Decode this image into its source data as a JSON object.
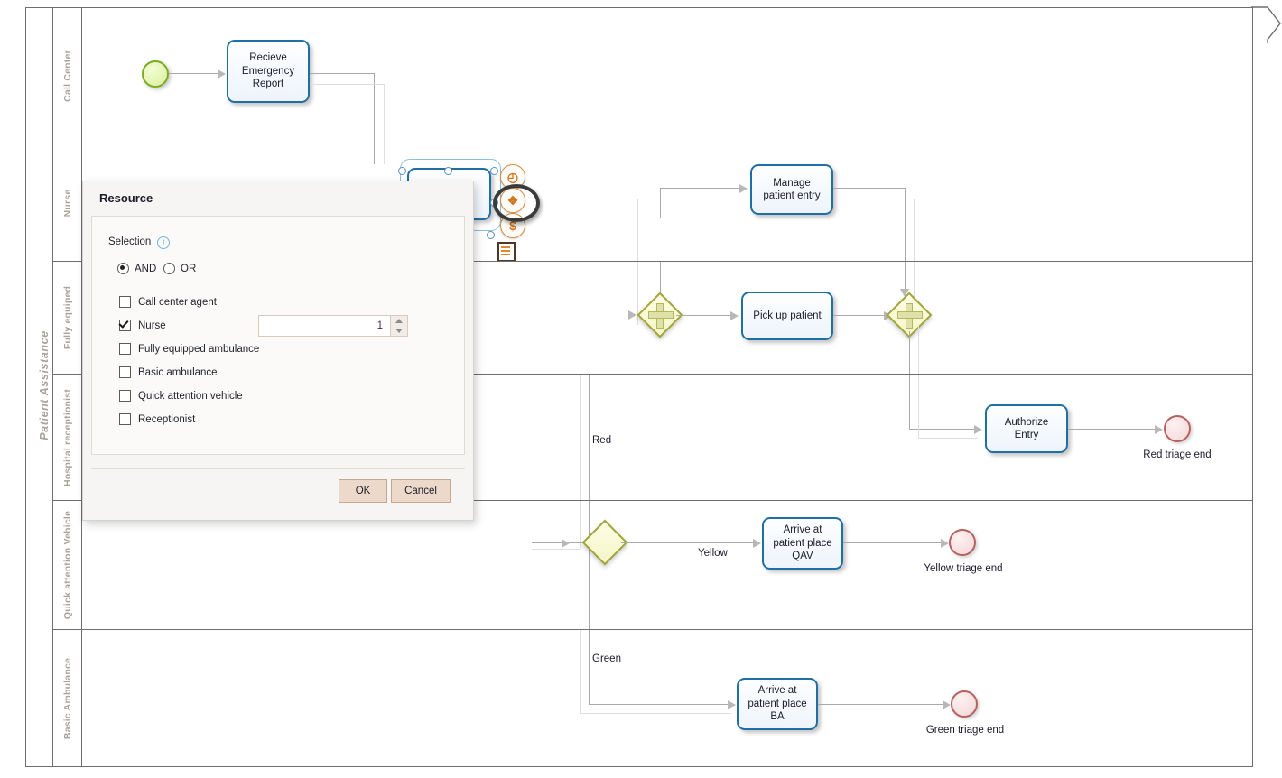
{
  "pool": {
    "title": "Patient Assistance",
    "lanes": [
      {
        "id": "call-center",
        "label": "Call Center"
      },
      {
        "id": "nurse",
        "label": "Nurse"
      },
      {
        "id": "fully-equiped",
        "label": "Fully equiped"
      },
      {
        "id": "hospital-receptionist",
        "label": "Hospital receptionist"
      },
      {
        "id": "quick-attention",
        "label": "Quick attention Vehicle"
      },
      {
        "id": "basic-ambulance",
        "label": "Basic Ambulance"
      }
    ]
  },
  "diagram": {
    "start_event": {
      "name": "start-event"
    },
    "tasks": [
      {
        "id": "recieve-emergency-report",
        "label": "Recieve Emergency Report"
      },
      {
        "id": "manage-patient-entry",
        "label": "Manage patient entry"
      },
      {
        "id": "pick-up-patient",
        "label": "Pick up patient"
      },
      {
        "id": "authorize-entry",
        "label": "Authorize Entry"
      },
      {
        "id": "arrive-patient-place-qav",
        "label": "Arrive at patient place QAV"
      },
      {
        "id": "arrive-patient-place-ba",
        "label": "Arrive at patient place BA"
      }
    ],
    "end_events": [
      {
        "id": "red-triage-end",
        "label": "Red triage end"
      },
      {
        "id": "yellow-triage-end",
        "label": "Yellow triage end"
      },
      {
        "id": "green-triage-end",
        "label": "Green triage end"
      }
    ],
    "flow_labels": [
      {
        "id": "red",
        "label": "Red"
      },
      {
        "id": "yellow",
        "label": "Yellow"
      },
      {
        "id": "green",
        "label": "Green"
      }
    ],
    "context_icons": [
      {
        "id": "duration",
        "glyph": "◴"
      },
      {
        "id": "resource",
        "glyph": "❖"
      },
      {
        "id": "cost",
        "glyph": "$"
      }
    ],
    "colors": {
      "task_border": "#1f6fa5",
      "start_event": "#7aac20",
      "end_event": "#b5615f",
      "gateway": "#a2a537",
      "lane_label": "#a9a29b",
      "connector": "#a9a9a9"
    }
  },
  "dialog": {
    "title": "Resource",
    "selection_label": "Selection",
    "info_glyph": "i",
    "logic": {
      "and": {
        "label": "AND",
        "selected": true
      },
      "or": {
        "label": "OR",
        "selected": false
      }
    },
    "resources": [
      {
        "id": "call-center-agent",
        "label": "Call center agent",
        "checked": false,
        "quantity": null
      },
      {
        "id": "nurse",
        "label": "Nurse",
        "checked": true,
        "quantity": "1"
      },
      {
        "id": "fully-equipped-ambulance",
        "label": "Fully equipped ambulance",
        "checked": false,
        "quantity": null
      },
      {
        "id": "basic-ambulance",
        "label": "Basic ambulance",
        "checked": false,
        "quantity": null
      },
      {
        "id": "quick-attention-vehicle",
        "label": "Quick attention vehicle",
        "checked": false,
        "quantity": null
      },
      {
        "id": "receptionist",
        "label": "Receptionist",
        "checked": false,
        "quantity": null
      }
    ],
    "quantity_value": "1",
    "buttons": {
      "ok": "OK",
      "cancel": "Cancel"
    },
    "accent": "#ecd9c9"
  }
}
